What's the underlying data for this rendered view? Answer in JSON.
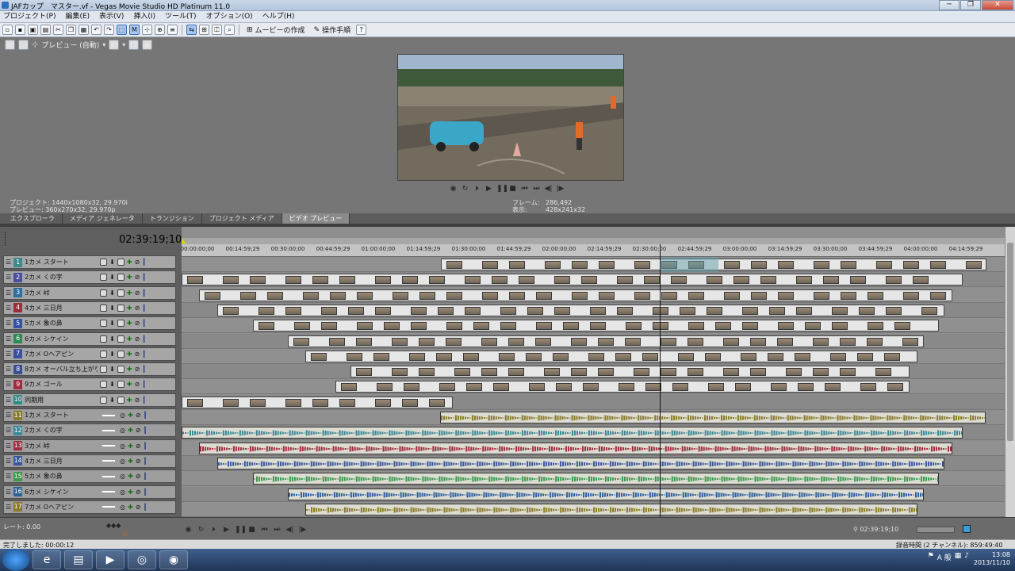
{
  "window": {
    "title": "JAFカップ　マスター.vf - Vegas Movie Studio HD Platinum 11.0",
    "controls": [
      "─",
      "❐",
      "✕"
    ]
  },
  "menu": [
    "プロジェクト(P)",
    "編集(E)",
    "表示(V)",
    "挿入(I)",
    "ツール(T)",
    "オプション(O)",
    "ヘルプ(H)"
  ],
  "toolbar": {
    "make_movie": "ムービーの作成",
    "guide": "操作手順"
  },
  "preview": {
    "mode": "プレビュー (自動)"
  },
  "project_info": {
    "line1": "プロジェクト: 1440x1080x32, 29.970i",
    "line2": "プレビュー: 360x270x32, 29.970p"
  },
  "frame_info": {
    "frame_label": "フレーム:",
    "frame_value": "286,492",
    "display_label": "表示:",
    "display_value": "428x241x32"
  },
  "tabs": [
    "エクスプローラ",
    "メディア ジェネレータ",
    "トランジション",
    "プロジェクト メディア",
    "ビデオ プレビュー"
  ],
  "timecode": "02:39:19;10",
  "ruler_ticks": [
    "00:00:00;00",
    "00:14:59;29",
    "00:30:00;00",
    "00:44:59;29",
    "01:00:00;00",
    "01:14:59;29",
    "01:30:00;00",
    "01:44:59;29",
    "02:00:00;00",
    "02:14:59;29",
    "02:30:00;00",
    "02:44:59;29",
    "03:00:00;00",
    "03:14:59;29",
    "03:30:00;00",
    "03:44:59;29",
    "04:00:00;00",
    "04:14:59;29",
    "04:3"
  ],
  "tracks": [
    {
      "num": "1",
      "name": "1カメ スタート",
      "color": "#3d8a8a"
    },
    {
      "num": "2",
      "name": "2カメ くの字",
      "color": "#4c4ca0"
    },
    {
      "num": "3",
      "name": "3カメ 峠",
      "color": "#2e6e9e"
    },
    {
      "num": "4",
      "name": "4カメ 三日月",
      "color": "#9c2c3c"
    },
    {
      "num": "5",
      "name": "5カメ 象の鼻",
      "color": "#3552a0"
    },
    {
      "num": "6",
      "name": "6カメ シケイン",
      "color": "#2f8a52"
    },
    {
      "num": "7",
      "name": "7カメ Oヘアピン",
      "color": "#3b4fa0"
    },
    {
      "num": "8",
      "name": "8カメ オーバル立ち上がり",
      "color": "#3a4f92"
    },
    {
      "num": "9",
      "name": "9カメ ゴール",
      "color": "#a32c40"
    },
    {
      "num": "10",
      "name": "同期用",
      "color": "#2a8a84"
    },
    {
      "num": "11",
      "name": "1カメ スタート",
      "color": "#8a7a28"
    },
    {
      "num": "12",
      "name": "2カメ くの字",
      "color": "#3b8898"
    },
    {
      "num": "13",
      "name": "3カメ 峠",
      "color": "#a02c40"
    },
    {
      "num": "14",
      "name": "4カメ 三日月",
      "color": "#3a56a0"
    },
    {
      "num": "15",
      "name": "5カメ 象の鼻",
      "color": "#3a9a4e"
    },
    {
      "num": "16",
      "name": "6カメ シケイン",
      "color": "#2e5fa0"
    },
    {
      "num": "17",
      "name": "7カメ Oヘアピン",
      "color": "#8a7a28"
    }
  ],
  "bottom": {
    "rate": "レート: 0.00",
    "timecode": "02:39:19;10"
  },
  "status": {
    "left": "完了しました: 00:00:12",
    "right": "録音時間 (2 チャンネル): 859:49:40"
  },
  "clock": {
    "time": "13:08",
    "date": "2013/11/10"
  },
  "tray": {
    "ime": "A 般"
  }
}
